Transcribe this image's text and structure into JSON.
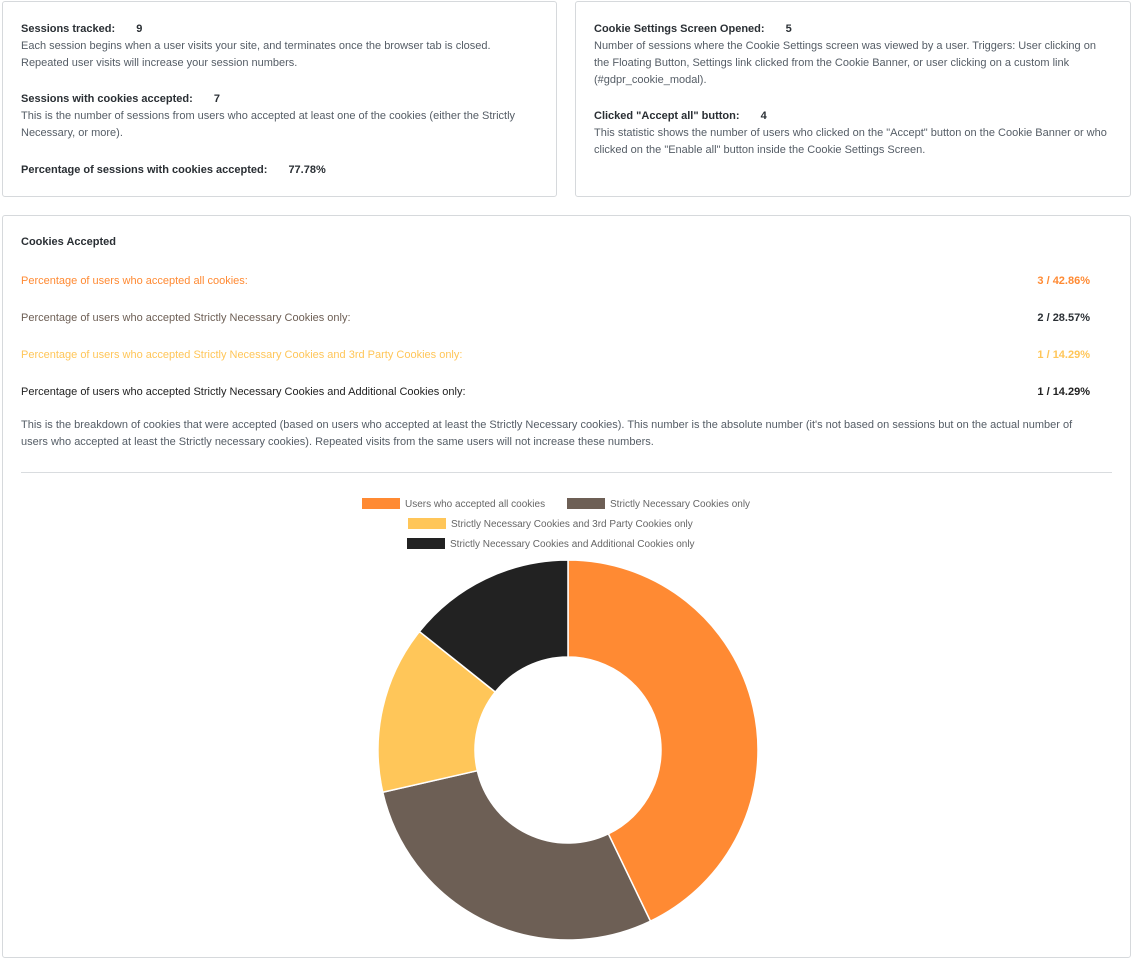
{
  "colors": {
    "all": "#ff8a33",
    "strictly": "#6d5f55",
    "third_party": "#ffc659",
    "additional": "#222222",
    "text_dark": "#2a2f34"
  },
  "sessions_card": {
    "tracked": {
      "title": "Sessions tracked:",
      "value": "9",
      "desc": "Each session begins when a user visits your site, and terminates once the browser tab is closed. Repeated user visits will increase your session numbers."
    },
    "with_cookies": {
      "title": "Sessions with cookies accepted:",
      "value": "7",
      "desc": "This is the number of sessions from users who accepted at least one of the cookies (either the Strictly Necessary, or more)."
    },
    "percentage": {
      "title": "Percentage of sessions with cookies accepted:",
      "value": "77.78%"
    }
  },
  "settings_card": {
    "opened": {
      "title": "Cookie Settings Screen Opened:",
      "value": "5",
      "desc": "Number of sessions where the Cookie Settings screen was viewed by a user. Triggers: User clicking on the Floating Button, Settings link clicked from the Cookie Banner, or user clicking on a custom link (#gdpr_cookie_modal)."
    },
    "accept_all": {
      "title": "Clicked \"Accept all\" button:",
      "value": "4",
      "desc": "This statistic shows the number of users who clicked on the \"Accept\" button on the Cookie Banner or who clicked on the \"Enable all\" button inside the Cookie Settings Screen."
    }
  },
  "cookies_accepted": {
    "title": "Cookies Accepted",
    "rows": [
      {
        "label": "Percentage of users who accepted all cookies:",
        "value": "3 / 42.86%"
      },
      {
        "label": "Percentage of users who accepted Strictly Necessary Cookies only:",
        "value": "2 / 28.57%"
      },
      {
        "label": "Percentage of users who accepted Strictly Necessary Cookies and 3rd Party Cookies only:",
        "value": "1 / 14.29%"
      },
      {
        "label": "Percentage of users who accepted Strictly Necessary Cookies and Additional Cookies only:",
        "value": "1 / 14.29%"
      }
    ],
    "breakdown": "This is the breakdown of cookies that were accepted (based on users who accepted at least the Strictly Necessary cookies). This number is the absolute number (it's not based on sessions but on the actual number of users who accepted at least the Strictly necessary cookies). Repeated visits from the same users will not increase these numbers."
  },
  "chart_data": {
    "type": "pie",
    "donut": true,
    "categories": [
      "Users who accepted all cookies",
      "Strictly Necessary Cookies only",
      "Strictly Necessary Cookies and 3rd Party Cookies only",
      "Strictly Necessary Cookies and Additional Cookies only"
    ],
    "values": [
      3,
      2,
      1,
      1
    ],
    "colors": [
      "#ff8a33",
      "#6d5f55",
      "#ffc659",
      "#222222"
    ],
    "legend": "top"
  }
}
